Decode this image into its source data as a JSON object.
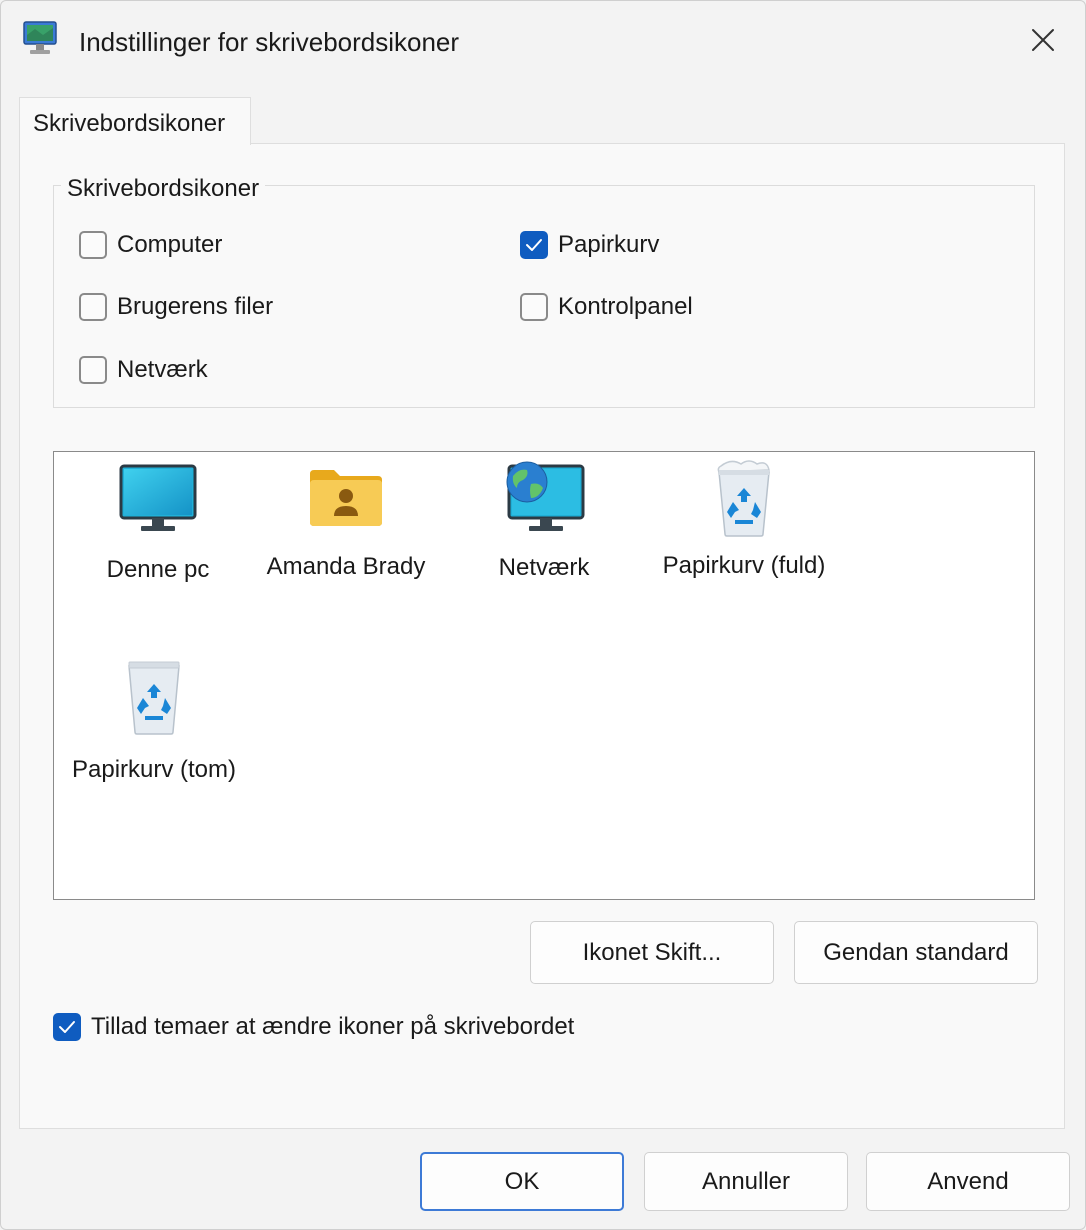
{
  "window": {
    "title": "Indstillinger for skrivebordsikoner"
  },
  "tab": {
    "label": "Skrivebordsikoner"
  },
  "group": {
    "legend": "Skrivebordsikoner",
    "checkboxes": [
      {
        "label": "Computer",
        "checked": false
      },
      {
        "label": "Brugerens filer",
        "checked": false
      },
      {
        "label": "Netværk",
        "checked": false
      },
      {
        "label": "Papirkurv",
        "checked": true
      },
      {
        "label": "Kontrolpanel",
        "checked": false
      }
    ]
  },
  "icons": [
    {
      "label": "Denne pc",
      "icon": "monitor-icon"
    },
    {
      "label": "Amanda Brady",
      "icon": "user-folder-icon"
    },
    {
      "label": "Netværk",
      "icon": "network-icon"
    },
    {
      "label": "Papirkurv (fuld)",
      "icon": "recycle-bin-full-icon"
    },
    {
      "label": "Papirkurv (tom)",
      "icon": "recycle-bin-empty-icon"
    }
  ],
  "buttons": {
    "change_icon": "Ikonet Skift...",
    "restore_default": "Gendan standard",
    "ok": "OK",
    "cancel": "Annuller",
    "apply": "Anvend"
  },
  "allow_themes": {
    "label": "Tillad temaer at ændre ikoner på skrivebordet",
    "checked": true
  },
  "colors": {
    "accent": "#0f5cc0",
    "monitor": "#1fb0d8",
    "folder": "#f5c242"
  }
}
